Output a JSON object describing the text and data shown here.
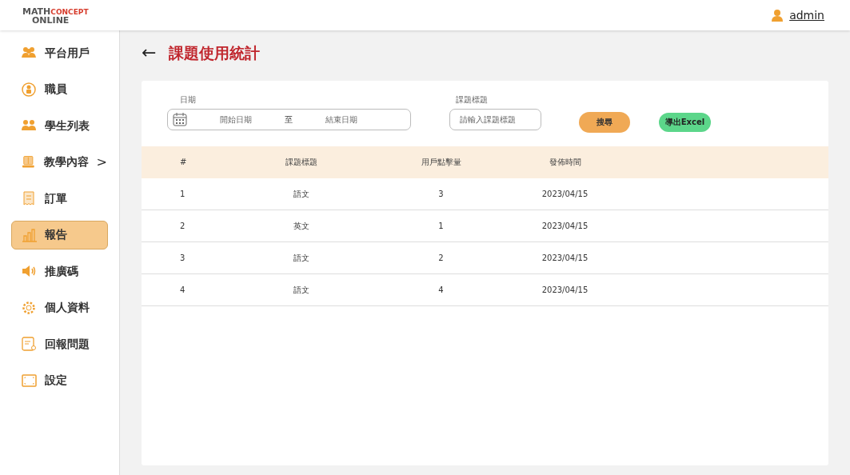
{
  "header": {
    "logo": {
      "first": "MATH",
      "second": "CONCEPT",
      "third": "ONLINE"
    },
    "user": "admin"
  },
  "sidebar": {
    "items": [
      {
        "label": "平台用戶",
        "selected": false
      },
      {
        "label": "職員",
        "selected": false
      },
      {
        "label": "學生列表",
        "selected": false
      },
      {
        "label": "教學內容",
        "selected": false,
        "chevron": ">"
      },
      {
        "label": "訂單",
        "selected": false
      },
      {
        "label": "報告",
        "selected": true
      },
      {
        "label": "推廣碼",
        "selected": false
      },
      {
        "label": "個人資料",
        "selected": false
      },
      {
        "label": "回報問題",
        "selected": false
      },
      {
        "label": "設定",
        "selected": false
      }
    ]
  },
  "page": {
    "back": "←",
    "title": "課題使用統計"
  },
  "filters": {
    "date_label": "日期",
    "start_placeholder": "開始日期",
    "separator": "至",
    "end_placeholder": "結束日期",
    "topic_label": "課題標題",
    "topic_placeholder": "請輸入課題標題",
    "search_button": "搜尋",
    "export_button": "導出Excel"
  },
  "table": {
    "columns": [
      "#",
      "課題標題",
      "用戶點擊量",
      "發佈時間"
    ],
    "rows": [
      [
        "1",
        "語文",
        "3",
        "2023/04/15"
      ],
      [
        "2",
        "英文",
        "1",
        "2023/04/15"
      ],
      [
        "3",
        "語文",
        "2",
        "2023/04/15"
      ],
      [
        "4",
        "語文",
        "4",
        "2023/04/15"
      ]
    ]
  }
}
